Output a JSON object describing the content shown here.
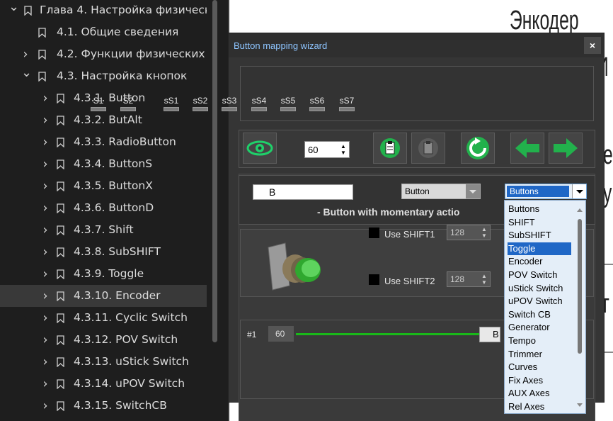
{
  "toc": {
    "items": [
      {
        "chevron": "down",
        "label": "Глава 4. Настройка физическ",
        "level": 0
      },
      {
        "chevron": "",
        "label": "4.1. Общие сведения",
        "level": 1
      },
      {
        "chevron": "right",
        "label": "4.2. Функции физических і",
        "level": 1
      },
      {
        "chevron": "down",
        "label": "4.3. Настройка кнопок",
        "level": 1
      },
      {
        "chevron": "right",
        "label": "4.3.1. Button",
        "level": 2
      },
      {
        "chevron": "right",
        "label": "4.3.2. ButAlt",
        "level": 2
      },
      {
        "chevron": "right",
        "label": "4.3.3. RadioButton",
        "level": 2
      },
      {
        "chevron": "right",
        "label": "4.3.4. ButtonS",
        "level": 2
      },
      {
        "chevron": "right",
        "label": "4.3.5. ButtonX",
        "level": 2
      },
      {
        "chevron": "right",
        "label": "4.3.6. ButtonD",
        "level": 2
      },
      {
        "chevron": "right",
        "label": "4.3.7. Shift",
        "level": 2
      },
      {
        "chevron": "right",
        "label": "4.3.8. SubSHIFT",
        "level": 2
      },
      {
        "chevron": "right",
        "label": "4.3.9. Toggle",
        "level": 2
      },
      {
        "chevron": "right",
        "label": "4.3.10. Encoder",
        "level": 2,
        "selected": true
      },
      {
        "chevron": "right",
        "label": "4.3.11. Cyclic Switch",
        "level": 2
      },
      {
        "chevron": "right",
        "label": "4.3.12. POV Switch",
        "level": 2
      },
      {
        "chevron": "right",
        "label": "4.3.13. uStick Switch",
        "level": 2
      },
      {
        "chevron": "right",
        "label": "4.3.14. uPOV Switch",
        "level": 2
      },
      {
        "chevron": "right",
        "label": "4.3.15. SwitchCB",
        "level": 2
      }
    ]
  },
  "background": {
    "heading_fragment": "Энкодер",
    "fragments": [
      "И",
      "е",
      "у",
      "г"
    ]
  },
  "dialog": {
    "title": "Button mapping wizard",
    "close_glyph": "×",
    "shift_labels": [
      "S1",
      "S2",
      "sS1",
      "sS2",
      "sS3",
      "sS4",
      "sS5",
      "sS6",
      "sS7"
    ],
    "spin_value": "60",
    "name_value": "B",
    "type_combo": "Button",
    "category_combo": "Buttons",
    "description": "- Button with momentary actio",
    "shift1_label": "Use SHIFT1",
    "shift1_value": "128",
    "shift2_label": "Use SHIFT2",
    "shift2_value": "128",
    "row_label": "#1",
    "row_value": "60",
    "row_button": "B"
  },
  "dropdown": {
    "items": [
      "Buttons",
      "SHIFT",
      "SubSHIFT",
      "Toggle",
      "Encoder",
      "POV Switch",
      "uStick Switch",
      "uPOV Switch",
      "Switch CB",
      "Generator",
      "Tempo",
      "Trimmer",
      "Curves",
      "Fix Axes",
      "AUX Axes",
      "Rel Axes"
    ],
    "highlighted": "Toggle"
  },
  "colors": {
    "toc_bg": "#1e1e1e",
    "dialog_bg": "#353535",
    "title_text": "#8ec5ff",
    "accent_green": "#19b819",
    "selection_blue": "#1f67c6"
  }
}
